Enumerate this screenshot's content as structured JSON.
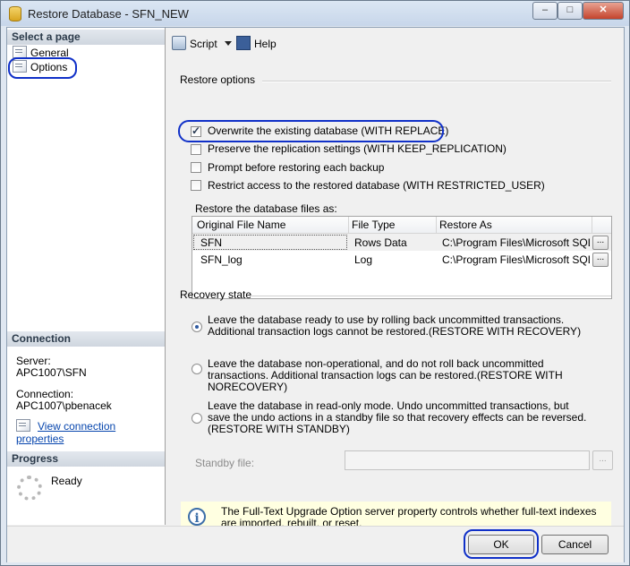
{
  "window": {
    "title": "Restore Database - SFN_NEW",
    "controls": [
      "–",
      "□",
      "✕"
    ]
  },
  "left": {
    "select_page_header": "Select a page",
    "pages": [
      {
        "label": "General"
      },
      {
        "label": "Options"
      }
    ],
    "connection_header": "Connection",
    "server_label": "Server:",
    "server_value": "APC1007\\SFN",
    "connection_label": "Connection:",
    "connection_value": "APC1007\\pbenacek",
    "view_properties_link": "View connection properties",
    "progress_header": "Progress",
    "progress_status": "Ready"
  },
  "toolbar": {
    "script_label": "Script",
    "help_label": "Help"
  },
  "restore_options": {
    "group_label": "Restore options",
    "checkboxes": [
      {
        "label": "Overwrite the existing database (WITH REPLACE)",
        "checked": true
      },
      {
        "label": "Preserve the replication settings (WITH KEEP_REPLICATION)",
        "checked": false
      },
      {
        "label": "Prompt before restoring each backup",
        "checked": false
      },
      {
        "label": "Restrict access to the restored database (WITH RESTRICTED_USER)",
        "checked": false
      }
    ],
    "files_label": "Restore the database files as:",
    "columns": [
      "Original File Name",
      "File Type",
      "Restore As"
    ],
    "rows": [
      {
        "original": "SFN",
        "type": "Rows Data",
        "restore_as": "C:\\Program Files\\Microsoft SQL..."
      },
      {
        "original": "SFN_log",
        "type": "Log",
        "restore_as": "C:\\Program Files\\Microsoft SQL..."
      }
    ],
    "browse_button": "..."
  },
  "recovery": {
    "group_label": "Recovery state",
    "options": [
      {
        "label": "Leave the database ready to use by rolling back uncommitted transactions. Additional transaction logs cannot be restored.(RESTORE WITH RECOVERY)",
        "selected": true
      },
      {
        "label": "Leave the database non-operational, and do not roll back uncommitted transactions. Additional transaction logs can be restored.(RESTORE WITH NORECOVERY)",
        "selected": false
      },
      {
        "label": "Leave the database in read-only mode. Undo uncommitted transactions, but save the undo actions in a standby file so that recovery effects can be reversed.(RESTORE WITH STANDBY)",
        "selected": false
      }
    ],
    "standby_label": "Standby file:",
    "standby_value": "",
    "standby_browse": "..."
  },
  "info": {
    "text": "The Full-Text Upgrade Option server property controls whether full-text indexes are imported, rebuilt, or reset."
  },
  "footer": {
    "ok_label": "OK",
    "cancel_label": "Cancel"
  },
  "colors": {
    "annotation_outline": "#1030c8",
    "link": "#0645ad",
    "info_background": "#ffffe1"
  }
}
